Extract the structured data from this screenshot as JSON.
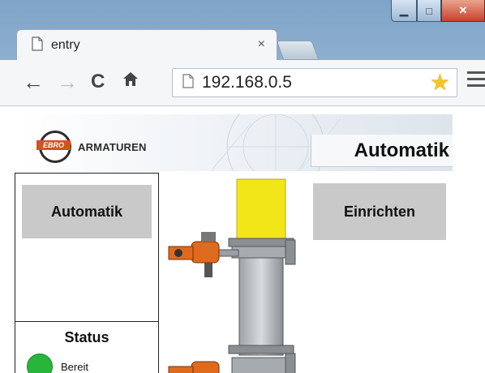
{
  "browser": {
    "tab_title": "entry",
    "tab_close": "×",
    "url": "192.168.0.5",
    "colors": {
      "frame": "#9fbdd9",
      "toolbar": "#f4f6f8",
      "star": "#f3c623"
    }
  },
  "page": {
    "logo": {
      "mark_text": "EBRO",
      "name": "ARMATUREN"
    },
    "mode_title": "Automatik",
    "buttons": {
      "automatic": "Automatik",
      "setup": "Einrichten"
    },
    "status": {
      "title": "Status",
      "state": "Bereit",
      "state_color": "#27b53a"
    },
    "colors": {
      "button_gray": "#c9c9c9",
      "actuator_yellow": "#f2e619",
      "valve_orange": "#e06a1c"
    }
  }
}
